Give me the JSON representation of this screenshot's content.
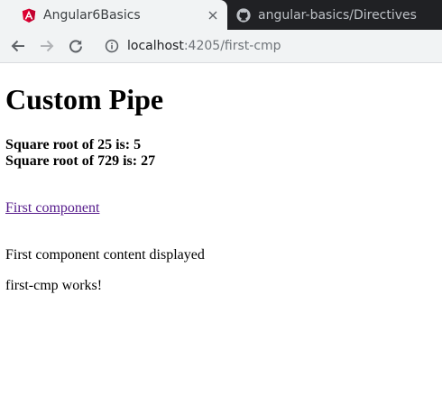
{
  "browser": {
    "tabs": [
      {
        "title": "Angular6Basics",
        "active": true,
        "favicon": "angular-icon"
      },
      {
        "title": "angular-basics/Directives",
        "active": false,
        "favicon": "github-icon"
      }
    ],
    "url": {
      "host": "localhost",
      "rest": ":4205/first-cmp"
    }
  },
  "page": {
    "heading": "Custom Pipe",
    "sqrt_lines": [
      "Square root of 25 is: 5",
      "Square root of 729 is: 27"
    ],
    "link_text": "First component",
    "content_text": "First component content displayed",
    "component_text": "first-cmp works!"
  },
  "colors": {
    "tabstrip_bg": "#202124",
    "toolbar_bg": "#f1f3f4",
    "angular_red": "#dd0031",
    "visited_link": "#551a8b"
  }
}
